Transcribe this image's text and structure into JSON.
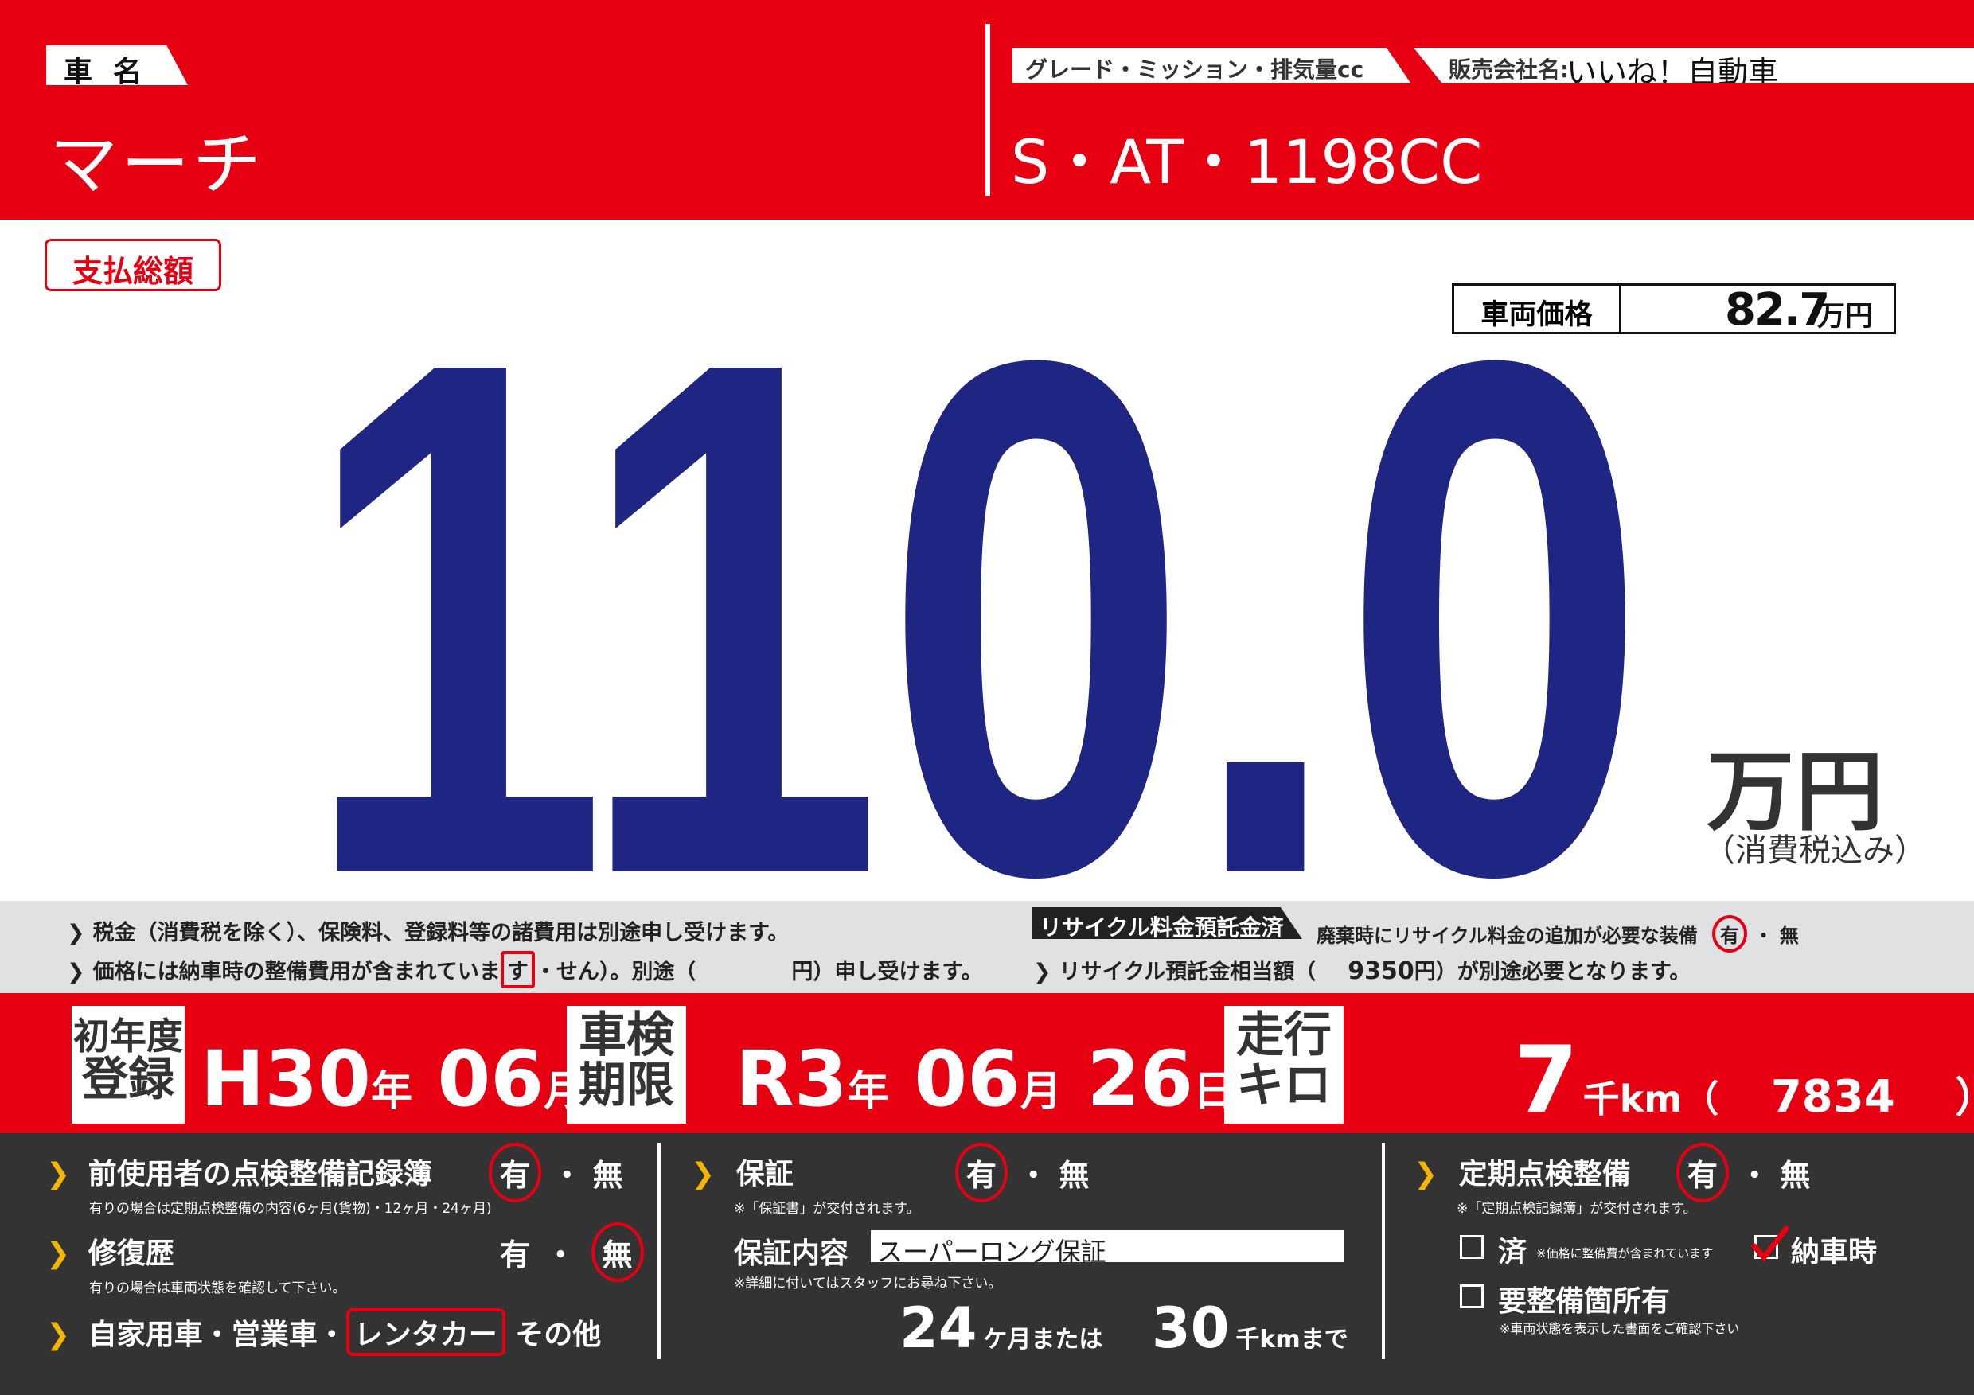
{
  "header": {
    "name_label": "車名",
    "car_name": "マーチ",
    "grade_label": "グレード・ミッション・排気量cc",
    "dealer_label": "販売会社名:",
    "dealer_name": "いいね！自動車",
    "grade_value": "S・AT・1198CC"
  },
  "price": {
    "total_label": "支払総額",
    "total_value": "110.0",
    "total_unit": "万円",
    "tax_note": "（消費税込み）",
    "vehicle_label": "車両価格",
    "vehicle_value": "82.7",
    "vehicle_unit": "万円"
  },
  "notes": {
    "line1": "税金（消費税を除く）、保険料、登録料等の諸費用は別途申し受けます。",
    "line2_a": "価格には納車時の整備費用が含まれていま",
    "line2_circled": "す",
    "line2_b": "・せん）。別途（",
    "line2_c": "円）申し受けます。",
    "recycle_label": "リサイクル料金預託金済",
    "recycle_equip": "廃棄時にリサイクル料金の追加が必要な装備",
    "yes": "有",
    "no": "無",
    "recycle_amount_a": "リサイクル預託金相当額（",
    "recycle_amount": "9350",
    "recycle_amount_b": "円）が別途必要となります。"
  },
  "band": {
    "first_reg_line1": "初年度",
    "first_reg_line2": "登録",
    "first_reg_year": "H30",
    "year_unit": "年",
    "first_reg_month": "06",
    "month_unit": "月",
    "inspection_line1": "車検",
    "inspection_line2": "期限",
    "inspection_year": "R3",
    "inspection_month": "06",
    "inspection_day": "26",
    "day_unit": "日",
    "mileage_line1": "走行",
    "mileage_line2": "キロ",
    "mileage_value": "7",
    "mileage_unit": "千km（",
    "mileage_exact": "7834",
    "mileage_close": "）"
  },
  "bottom": {
    "records_label": "前使用者の点検整備記録簿",
    "records_note": "有りの場合は定期点検整備の内容(6ヶ月(貨物)・12ヶ月・24ヶ月)",
    "repair_label": "修復歴",
    "repair_note": "有りの場合は車両状態を確認して下さい。",
    "usage_a": "自家用車・営業車・",
    "usage_selected": "レンタカー",
    "usage_b": "その他",
    "warranty_label": "保証",
    "warranty_note": "※「保証書」が交付されます。",
    "warranty_content_label": "保証内容",
    "warranty_content": "スーパーロング保証",
    "warranty_detail_note": "※詳細に付いてはスタッフにお尋ね下さい。",
    "warranty_months": "24",
    "warranty_months_unit": "ケ月または",
    "warranty_km": "30",
    "warranty_km_unit": "千kmまで",
    "periodic_label": "定期点検整備",
    "periodic_note": "※「定期点検記録簿」が交付されます。",
    "done_label": "済",
    "done_note": "※価格に整備費が含まれています",
    "delivery_label": "納車時",
    "needs_label": "要整備箇所有",
    "needs_note": "※車両状態を表示した書面をご確認下さい",
    "dot": "・"
  },
  "colors": {
    "red": "#e60012",
    "navy": "#1f2582",
    "dark": "#333333",
    "grey": "#e0e1e2"
  }
}
